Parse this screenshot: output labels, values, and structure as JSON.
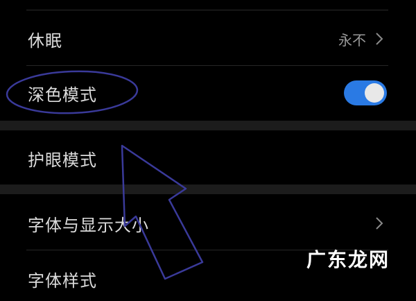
{
  "settings": {
    "sleep": {
      "label": "休眠",
      "value": "永不"
    },
    "dark_mode": {
      "label": "深色模式",
      "enabled": true
    },
    "eye_comfort": {
      "label": "护眼模式"
    },
    "font_display_size": {
      "label": "字体与显示大小"
    },
    "font_style": {
      "label": "字体样式"
    }
  },
  "colors": {
    "toggle_on": "#2a7ae4",
    "annotation": "#3a3a9a"
  },
  "watermark": {
    "text": "广东龙网"
  }
}
